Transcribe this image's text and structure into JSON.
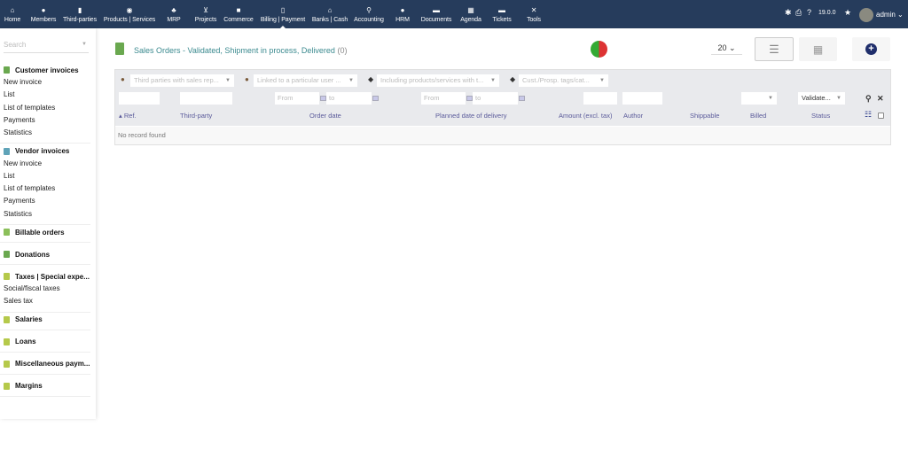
{
  "topbar": {
    "menu": [
      {
        "icon": "home-icon",
        "glyph": "⌂",
        "label": "Home"
      },
      {
        "icon": "user-icon",
        "glyph": "●",
        "label": "Members"
      },
      {
        "icon": "building-icon",
        "glyph": "▮",
        "label": "Third-parties"
      },
      {
        "icon": "cube-icon",
        "glyph": "◉",
        "label": "Products | Services"
      },
      {
        "icon": "cubes-icon",
        "glyph": "♣",
        "label": "MRP"
      },
      {
        "icon": "sitemap-icon",
        "glyph": "⊻",
        "label": "Projects"
      },
      {
        "icon": "suitcase-icon",
        "glyph": "■",
        "label": "Commerce"
      },
      {
        "icon": "file-invoice-icon",
        "glyph": "▯",
        "label": "Billing | Payment"
      },
      {
        "icon": "bank-icon",
        "glyph": "⌂",
        "label": "Banks | Cash"
      },
      {
        "icon": "search-dollar-icon",
        "glyph": "⚲",
        "label": "Accounting"
      },
      {
        "icon": "user-tie-icon",
        "glyph": "●",
        "label": "HRM"
      },
      {
        "icon": "folder-icon",
        "glyph": "▬",
        "label": "Documents"
      },
      {
        "icon": "calendar-icon",
        "glyph": "▦",
        "label": "Agenda"
      },
      {
        "icon": "ticket-icon",
        "glyph": "▬",
        "label": "Tickets"
      },
      {
        "icon": "tools-icon",
        "glyph": "✕",
        "label": "Tools"
      }
    ],
    "version": "19.0.0",
    "user": "admin"
  },
  "sidebar": {
    "search_placeholder": "Search",
    "sections": [
      {
        "title": "Customer invoices",
        "color": "#6aa84f",
        "items": [
          "New invoice",
          "List",
          "List of templates",
          "Payments",
          "Statistics"
        ]
      },
      {
        "title": "Vendor invoices",
        "color": "#5fa3b8",
        "items": [
          "New invoice",
          "List",
          "List of templates",
          "Payments",
          "Statistics"
        ]
      },
      {
        "title": "Billable orders",
        "color": "#8bbf5a",
        "items": []
      },
      {
        "title": "Donations",
        "color": "#6aa84f",
        "items": []
      },
      {
        "title": "Taxes | Special expe...",
        "color": "#b5c94a",
        "items": [
          "Social/fiscal taxes",
          "Sales tax"
        ]
      },
      {
        "title": "Salaries",
        "color": "#b5c94a",
        "items": []
      },
      {
        "title": "Loans",
        "color": "#b5c94a",
        "items": []
      },
      {
        "title": "Miscellaneous paym...",
        "color": "#b5c94a",
        "items": []
      },
      {
        "title": "Margins",
        "color": "#b5c94a",
        "items": []
      }
    ]
  },
  "main": {
    "title": "Sales Orders - Validated, Shipment in process, Delivered",
    "count": "(0)",
    "per_page": "20",
    "filters": {
      "sales_rep": "Third parties with sales rep...",
      "user": "Linked to a particular user ...",
      "products": "Including products/services with t...",
      "tags": "Cust./Prosp. tags/cat...",
      "from": "From",
      "to": "to",
      "status": "Validate..."
    },
    "columns": [
      "Ref.",
      "Third-party",
      "Order date",
      "Planned date of delivery",
      "Amount (excl. tax)",
      "Author",
      "Shippable",
      "Billed",
      "Status"
    ],
    "empty": "No record found"
  }
}
